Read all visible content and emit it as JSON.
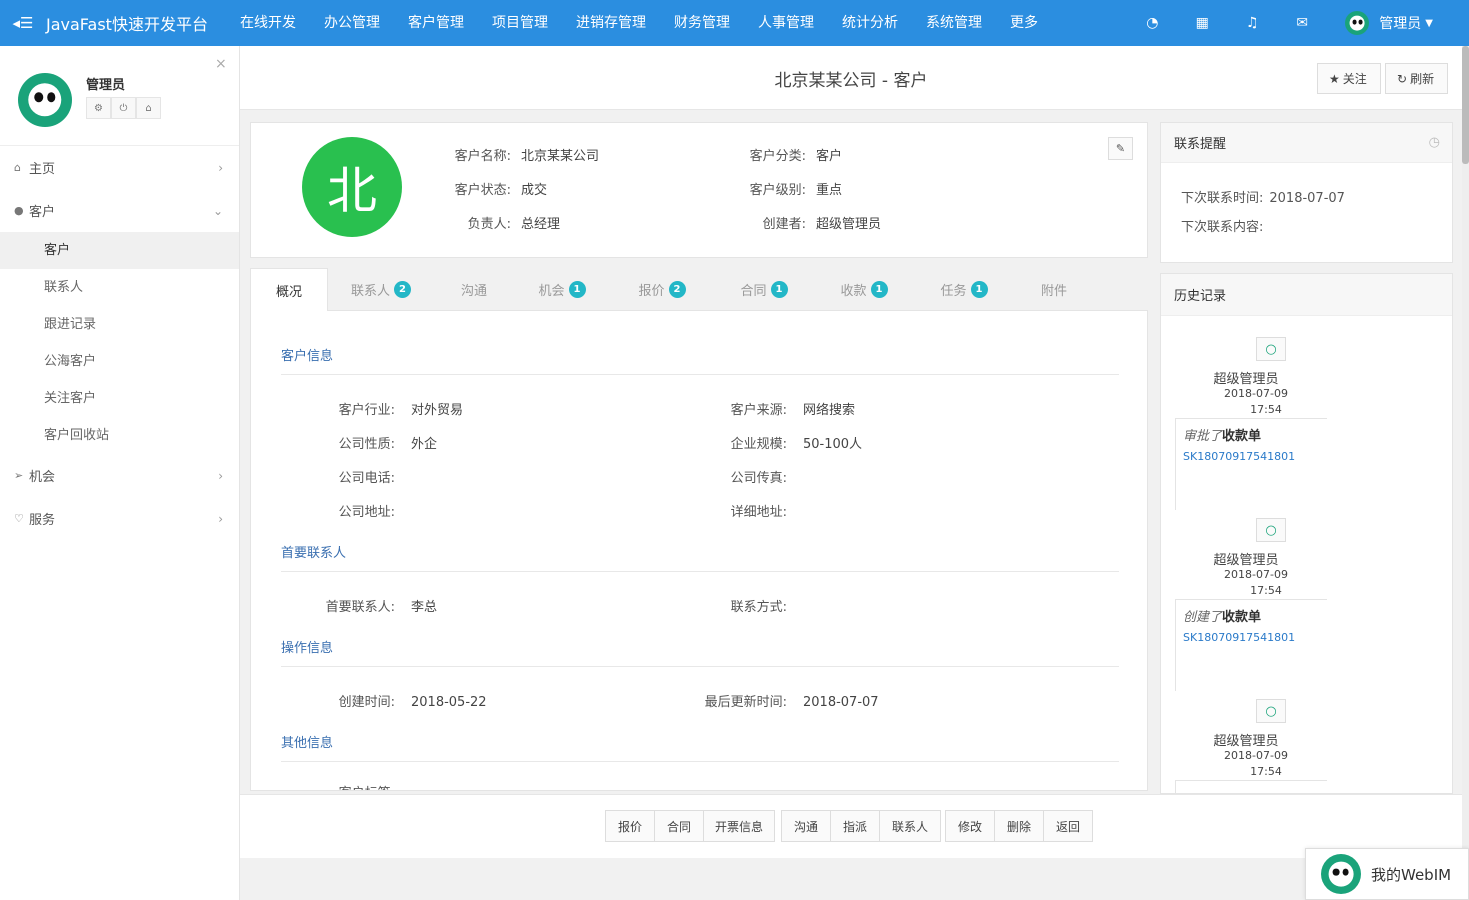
{
  "topbar": {
    "brand": "JavaFast快速开发平台",
    "nav": [
      "在线开发",
      "办公管理",
      "客户管理",
      "项目管理",
      "进销存管理",
      "财务管理",
      "人事管理",
      "统计分析",
      "系统管理",
      "更多"
    ],
    "user": "管理员"
  },
  "sidebar": {
    "user_name": "管理员",
    "items": [
      {
        "label": "主页",
        "icon": "home-icon"
      },
      {
        "label": "客户",
        "icon": "user-icon"
      },
      {
        "label": "机会",
        "icon": "paper-plane-icon"
      },
      {
        "label": "服务",
        "icon": "heart-icon"
      }
    ],
    "sub_items": [
      "客户",
      "联系人",
      "跟进记录",
      "公海客户",
      "关注客户",
      "客户回收站"
    ]
  },
  "header": {
    "title": "北京某某公司 - 客户",
    "follow": "关注",
    "refresh": "刷新"
  },
  "summary": {
    "avatar_char": "北",
    "fields": [
      {
        "k": "客户名称:",
        "v": "北京某某公司"
      },
      {
        "k": "客户分类:",
        "v": "客户"
      },
      {
        "k": "客户状态:",
        "v": "成交"
      },
      {
        "k": "客户级别:",
        "v": "重点"
      },
      {
        "k": "负责人:",
        "v": "总经理"
      },
      {
        "k": "创建者:",
        "v": "超级管理员"
      }
    ]
  },
  "tabs": [
    {
      "label": "概况",
      "badge": ""
    },
    {
      "label": "联系人",
      "badge": "2"
    },
    {
      "label": "沟通",
      "badge": ""
    },
    {
      "label": "机会",
      "badge": "1"
    },
    {
      "label": "报价",
      "badge": "2"
    },
    {
      "label": "合同",
      "badge": "1"
    },
    {
      "label": "收款",
      "badge": "1"
    },
    {
      "label": "任务",
      "badge": "1"
    },
    {
      "label": "附件",
      "badge": ""
    }
  ],
  "overview": {
    "sections": [
      "客户信息",
      "首要联系人",
      "操作信息",
      "其他信息"
    ],
    "customer_info": [
      {
        "k": "客户行业:",
        "v": "对外贸易"
      },
      {
        "k": "客户来源:",
        "v": "网络搜索"
      },
      {
        "k": "公司性质:",
        "v": "外企"
      },
      {
        "k": "企业规模:",
        "v": "50-100人"
      },
      {
        "k": "公司电话:",
        "v": ""
      },
      {
        "k": "公司传真:",
        "v": ""
      },
      {
        "k": "公司地址:",
        "v": ""
      },
      {
        "k": "详细地址:",
        "v": ""
      }
    ],
    "primary_contact": [
      {
        "k": "首要联系人:",
        "v": "李总"
      },
      {
        "k": "联系方式:",
        "v": ""
      }
    ],
    "operation_info": [
      {
        "k": "创建时间:",
        "v": "2018-05-22"
      },
      {
        "k": "最后更新时间:",
        "v": "2018-07-07"
      }
    ],
    "other_info": [
      {
        "k": "客户标签:",
        "v": ""
      }
    ]
  },
  "actions": [
    "报价",
    "合同",
    "开票信息",
    "沟通",
    "指派",
    "联系人",
    "修改",
    "删除",
    "返回"
  ],
  "reminder": {
    "title": "联系提醒",
    "next_time_label": "下次联系时间:",
    "next_time": "2018-07-07",
    "next_content_label": "下次联系内容:"
  },
  "history": {
    "title": "历史记录",
    "entries": [
      {
        "user": "超级管理员",
        "date": "2018-07-09",
        "time": "17:54",
        "verb": "审批了",
        "object": "收款单",
        "link": "SK18070917541801"
      },
      {
        "user": "超级管理员",
        "date": "2018-07-09",
        "time": "17:54",
        "verb": "创建了",
        "object": "收款单",
        "link": "SK18070917541801"
      },
      {
        "user": "超级管理员",
        "date": "2018-07-09",
        "time": "17:54"
      }
    ]
  },
  "webim": {
    "label": "我的WebIM"
  },
  "colors": {
    "topbar": "#2b8ee0",
    "avatar": "#29c04f",
    "badge": "#23b7c7",
    "section": "#3a6fb0"
  }
}
